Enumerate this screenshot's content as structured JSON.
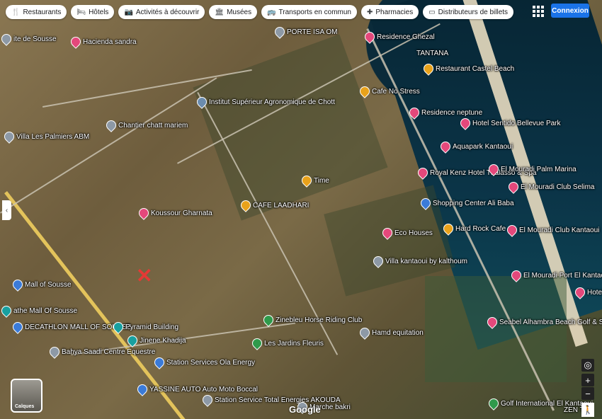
{
  "chips": [
    {
      "icon": "restaurant-icon",
      "glyph": "🍴",
      "label": "Restaurants"
    },
    {
      "icon": "hotel-icon",
      "glyph": "🛏",
      "label": "Hôtels"
    },
    {
      "icon": "camera-icon",
      "glyph": "📷",
      "label": "Activités à découvrir"
    },
    {
      "icon": "museum-icon",
      "glyph": "🏛",
      "label": "Musées"
    },
    {
      "icon": "transit-icon",
      "glyph": "🚌",
      "label": "Transports en commun"
    },
    {
      "icon": "pharmacy-icon",
      "glyph": "✚",
      "label": "Pharmacies"
    },
    {
      "icon": "atm-icon",
      "glyph": "▭",
      "label": "Distributeurs de billets"
    }
  ],
  "signin_label": "Connexion",
  "layers_label": "Calques",
  "google_logo": "Google",
  "collapse_glyph": "‹",
  "zoom_in": "+",
  "zoom_out": "−",
  "pois": [
    {
      "label": "ite de Sousse",
      "type": "gray"
    },
    {
      "label": "Hacienda sandra",
      "type": "hotel"
    },
    {
      "label": "PORTE ISA OM",
      "type": "gray"
    },
    {
      "label": "Residence Ghezal",
      "type": "hotel"
    },
    {
      "label": "TANTANA",
      "type": "none"
    },
    {
      "label": "Restaurant Castel Beach",
      "type": "food"
    },
    {
      "label": "Cafe No Stress",
      "type": "food"
    },
    {
      "label": "Institut Supérieur Agronomique de Chott",
      "type": "edu"
    },
    {
      "label": "Residence neptune",
      "type": "hotel"
    },
    {
      "label": "Hotel Sentido Bellevue Park",
      "type": "hotel"
    },
    {
      "label": "Chantier chatt mariem",
      "type": "gray"
    },
    {
      "label": "Villa Les Palmiers ABM",
      "type": "gray"
    },
    {
      "label": "Aquapark Kantaoui",
      "type": "hotel"
    },
    {
      "label": "Royal Kenz Hotel Thalasso & Spa",
      "type": "hotel"
    },
    {
      "label": "El Mouradi Palm Marina",
      "type": "hotel"
    },
    {
      "label": "Time",
      "type": "food"
    },
    {
      "label": "El Mouradi Club Selima",
      "type": "hotel"
    },
    {
      "label": "CAFE LAADHARI",
      "type": "food"
    },
    {
      "label": "Shopping Center Ali Baba",
      "type": "shop"
    },
    {
      "label": "Koussour Gharnata",
      "type": "hotel"
    },
    {
      "label": "Eco Houses",
      "type": "hotel"
    },
    {
      "label": "Hard Rock Cafe",
      "type": "food"
    },
    {
      "label": "El Mouradi Club Kantaoui",
      "type": "hotel"
    },
    {
      "label": "Villa kantaoui by kalthoum",
      "type": "gray"
    },
    {
      "label": "Mall of Sousse",
      "type": "shop"
    },
    {
      "label": "El Mouradi Port El Kantaoui",
      "type": "hotel"
    },
    {
      "label": "Hotel SELECT",
      "type": "hotel"
    },
    {
      "label": "athe Mall Of Sousse",
      "type": "teal"
    },
    {
      "label": "Zinebleu Horse Riding Club",
      "type": "park"
    },
    {
      "label": "DECATHLON MALL OF SOUSSE",
      "type": "shop"
    },
    {
      "label": "Pyramid Building",
      "type": "teal"
    },
    {
      "label": "Hamd equitation",
      "type": "gray"
    },
    {
      "label": "Seabel Alhambra Beach Golf & Spa Port",
      "type": "hotel"
    },
    {
      "label": "Les Jardins Fleuris",
      "type": "park"
    },
    {
      "label": "Jinene Khadija",
      "type": "teal"
    },
    {
      "label": "Bahya Saadi Centre Equestre",
      "type": "gray"
    },
    {
      "label": "Station Services Ola Energy",
      "type": "shop"
    },
    {
      "label": "YASSINE AUTO Auto Moto Boccal",
      "type": "shop"
    },
    {
      "label": "Station Service Total Energies AKOUDA",
      "type": "gray"
    },
    {
      "label": "Marche bakri",
      "type": "gray"
    },
    {
      "label": "Golf International El Kantaoui",
      "type": "park"
    },
    {
      "label": "ZEN T",
      "type": "none"
    }
  ]
}
